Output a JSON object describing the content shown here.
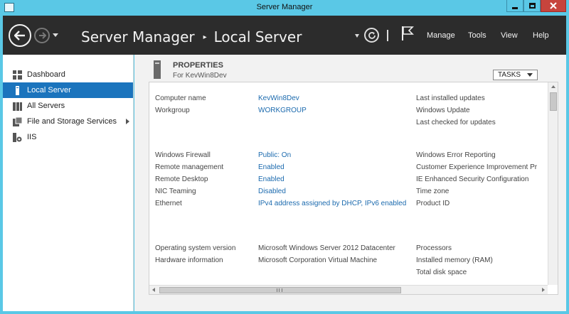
{
  "window": {
    "title": "Server Manager"
  },
  "header": {
    "breadcrumb_root": "Server Manager",
    "breadcrumb_separator": "▸",
    "breadcrumb_current": "Local Server",
    "menu": [
      "Manage",
      "Tools",
      "View",
      "Help"
    ]
  },
  "sidebar": {
    "items": [
      {
        "label": "Dashboard",
        "icon": "dashboard-icon",
        "active": false
      },
      {
        "label": "Local Server",
        "icon": "server-icon",
        "active": true
      },
      {
        "label": "All Servers",
        "icon": "servers-icon",
        "active": false
      },
      {
        "label": "File and Storage Services",
        "icon": "storage-icon",
        "active": false,
        "has_children": true
      },
      {
        "label": "IIS",
        "icon": "iis-icon",
        "active": false
      }
    ]
  },
  "properties": {
    "title": "PROPERTIES",
    "subtitle": "For KevWin8Dev",
    "tasks_label": "TASKS",
    "group1": {
      "labels": [
        "Computer name",
        "Workgroup"
      ],
      "values": [
        "KevWin8Dev",
        "WORKGROUP"
      ],
      "right": [
        "Last installed updates",
        "Windows Update",
        "Last checked for updates"
      ]
    },
    "group2": {
      "labels": [
        "Windows Firewall",
        "Remote management",
        "Remote Desktop",
        "NIC Teaming",
        "Ethernet"
      ],
      "values": [
        "Public: On",
        "Enabled",
        "Enabled",
        "Disabled",
        "IPv4 address assigned by DHCP, IPv6 enabled"
      ],
      "right": [
        "Windows Error Reporting",
        "Customer Experience Improvement Pr",
        "IE Enhanced Security Configuration",
        "Time zone",
        "Product ID"
      ]
    },
    "group3": {
      "labels": [
        "Operating system version",
        "Hardware information"
      ],
      "values": [
        "Microsoft Windows Server 2012 Datacenter",
        "Microsoft Corporation Virtual Machine"
      ],
      "right": [
        "Processors",
        "Installed memory (RAM)",
        "Total disk space"
      ]
    }
  },
  "colors": {
    "accent": "#1b74bd",
    "link": "#1b6aae",
    "header_bg": "#2c2c2c",
    "frame": "#5ac8e6"
  }
}
